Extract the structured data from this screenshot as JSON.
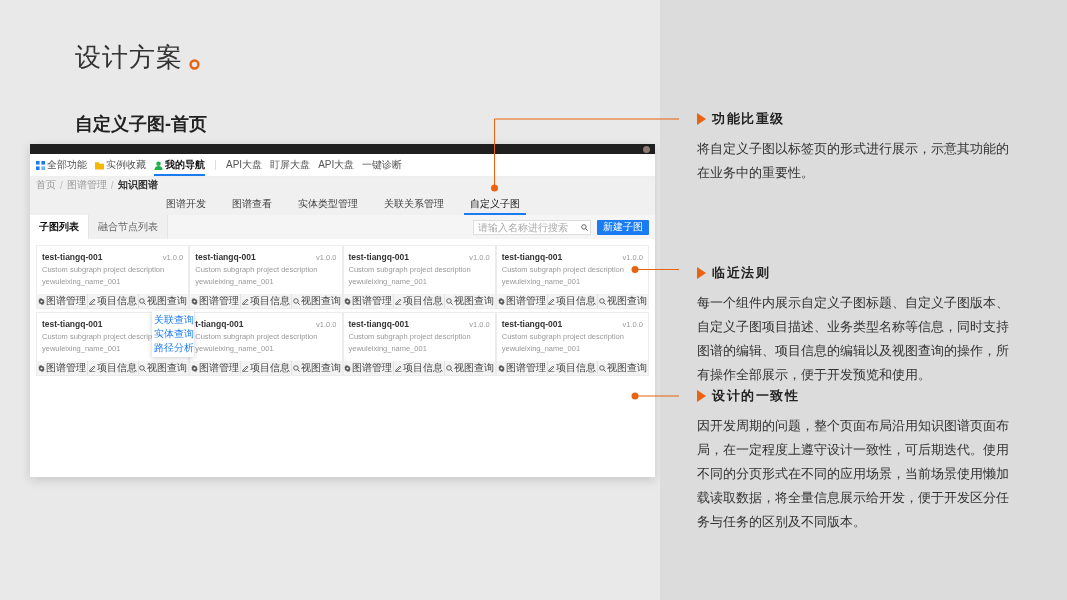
{
  "slide": {
    "title": "设计方案",
    "subtitle": "自定义子图-首页"
  },
  "mockup": {
    "nav": [
      {
        "label": "全部功能",
        "selected": false
      },
      {
        "label": "实例收藏",
        "selected": false
      },
      {
        "label": "我的导航",
        "selected": true
      },
      {
        "label": "API大盘",
        "selected": false
      },
      {
        "label": "盯屏大盘",
        "selected": false
      },
      {
        "label": "API大盘",
        "selected": false
      },
      {
        "label": "一键诊断",
        "selected": false
      }
    ],
    "breadcrumb": [
      "首页",
      "图谱管理",
      "知识图谱"
    ],
    "breadcrumb_separator": "/",
    "tabs": [
      {
        "label": "图谱开发",
        "selected": false
      },
      {
        "label": "图谱查看",
        "selected": false
      },
      {
        "label": "实体类型管理",
        "selected": false
      },
      {
        "label": "关联关系管理",
        "selected": false
      },
      {
        "label": "自定义子图",
        "selected": true
      }
    ],
    "subtabs": [
      {
        "label": "子图列表",
        "selected": true
      },
      {
        "label": "融合节点列表",
        "selected": false
      }
    ],
    "search": {
      "placeholder": "请输入名称进行搜索"
    },
    "create_button": "新建子图",
    "cards": [
      {
        "title": "test-tiangq-001",
        "version": "v1.0.0",
        "description": "Custom subgraph project description",
        "business_type": "yewuleixing_name_001",
        "actions": [
          "图谱管理",
          "项目信息",
          "视图查询"
        ]
      },
      {
        "title": "test-tiangq-001",
        "version": "v1.0.0",
        "description": "Custom subgraph project description",
        "business_type": "yewuleixing_name_001",
        "actions": [
          "图谱管理",
          "项目信息",
          "视图查询"
        ]
      },
      {
        "title": "test-tiangq-001",
        "version": "v1.0.0",
        "description": "Custom subgraph project description",
        "business_type": "yewuleixing_name_001",
        "actions": [
          "图谱管理",
          "项目信息",
          "视图查询"
        ]
      },
      {
        "title": "test-tiangq-001",
        "version": "v1.0.0",
        "description": "Custom subgraph project description",
        "business_type": "yewuleixing_name_001",
        "actions": [
          "图谱管理",
          "项目信息",
          "视图查询"
        ]
      },
      {
        "title": "test-tiangq-001",
        "description": "Custom subgraph project descrip",
        "business_type": "yewuleixing_name_001",
        "actions": [
          "图谱管理",
          "项目信息",
          "视图查询"
        ]
      },
      {
        "title": "t-tiangq-001",
        "version": "v1.0.0",
        "description": "Custom subgraph project description",
        "business_type": "yewuleixing_name_001",
        "actions": [
          "图谱管理",
          "项目信息",
          "视图查询"
        ]
      },
      {
        "title": "test-tiangq-001",
        "version": "v1.0.0",
        "description": "Custom subgraph project description",
        "business_type": "yewuleixing_name_001",
        "actions": [
          "图谱管理",
          "项目信息",
          "视图查询"
        ]
      },
      {
        "title": "test-tiangq-001",
        "version": "v1.0.0",
        "description": "Custom subgraph project description",
        "business_type": "yewuleixing_name_001",
        "actions": [
          "图谱管理",
          "项目信息",
          "视图查询"
        ]
      }
    ],
    "dropdown": {
      "items": [
        "关联查询",
        "实体查询",
        "路径分析"
      ]
    }
  },
  "notes": [
    {
      "heading": "功能比重级",
      "text": "将自定义子图以标签页的形式进行展示，示意其功能的在业务中的重要性。"
    },
    {
      "heading": "临近法则",
      "text": "每一个组件内展示自定义子图标题、自定义子图版本、自定义子图项目描述、业务类型名称等信息，同时支持图谱的编辑、项目信息的编辑以及视图查询的操作，所有操作全部展示，便于开发预览和使用。"
    },
    {
      "heading": "设计的一致性",
      "text": "因开发周期的问题，整个页面布局沿用知识图谱页面布局，在一定程度上遵守设计一致性，可后期迭代。使用不同的分页形式在不同的应用场景，当前场景使用懒加载读取数据，将全量信息展示给开发，便于开发区分任务与任务的区别及不同版本。"
    }
  ]
}
